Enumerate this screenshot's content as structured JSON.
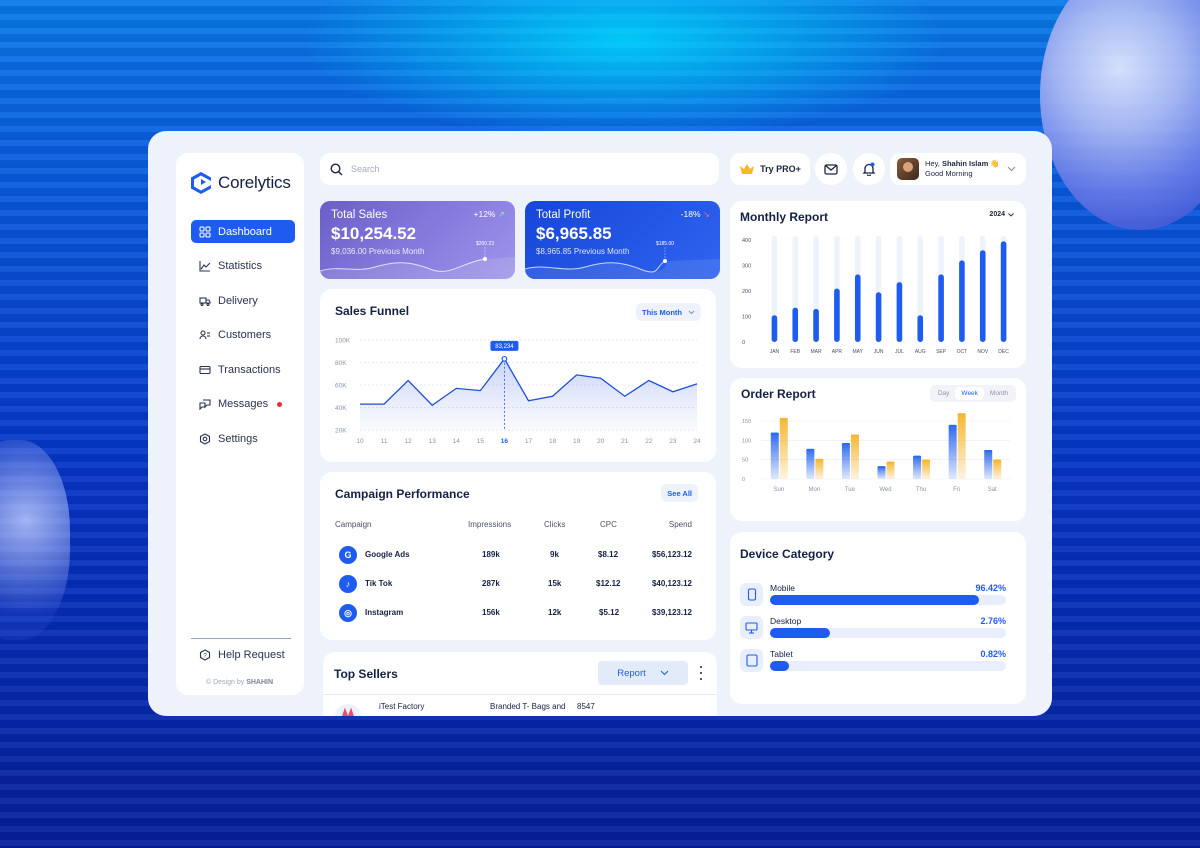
{
  "brand": {
    "name": "Corelytics"
  },
  "sidebar": {
    "items": [
      {
        "label": "Dashboard",
        "icon": "grid-icon"
      },
      {
        "label": "Statistics",
        "icon": "chart-icon"
      },
      {
        "label": "Delivery",
        "icon": "truck-icon"
      },
      {
        "label": "Customers",
        "icon": "users-icon"
      },
      {
        "label": "Transactions",
        "icon": "card-icon"
      },
      {
        "label": "Messages",
        "icon": "chat-icon"
      },
      {
        "label": "Settings",
        "icon": "settings-icon"
      }
    ],
    "help": "Help Request",
    "credit_prefix": "© Design by",
    "credit_name": "SHAHIN"
  },
  "search": {
    "placeholder": "Search"
  },
  "header": {
    "pro_label": "Try PRO+",
    "greeting_prefix": "Hey,",
    "user_name": "Shahin Islam",
    "wave": "👋",
    "subtitle": "Good Morning"
  },
  "kpi": {
    "sales": {
      "title": "Total Sales",
      "value": "$10,254.52",
      "delta": "+12%",
      "previous": "$9,036.00 Previous Month",
      "tag": "$200.23"
    },
    "profit": {
      "title": "Total Profit",
      "value": "$6,965.85",
      "delta": "-18%",
      "previous": "$8,965.85 Previous Month",
      "tag": "$185.00"
    }
  },
  "funnel": {
    "title": "Sales Funnel",
    "filter": "This Month",
    "tooltip": "83,234",
    "chart_data": {
      "type": "area",
      "x": [
        10,
        11,
        12,
        13,
        14,
        15,
        16,
        17,
        18,
        19,
        20,
        21,
        22,
        23,
        24
      ],
      "y_ticks": [
        "100K",
        "80K",
        "60K",
        "40K",
        "20K"
      ],
      "ylim": [
        20000,
        100000
      ],
      "values": [
        43000,
        43000,
        64000,
        42000,
        57000,
        55000,
        83234,
        46000,
        50000,
        69000,
        66000,
        50000,
        64000,
        54000,
        61000
      ],
      "highlight_x": 16
    }
  },
  "campaign": {
    "title": "Campaign Performance",
    "see_all": "See All",
    "columns": [
      "Campaign",
      "Impressions",
      "Clicks",
      "CPC",
      "Spend"
    ],
    "rows": [
      {
        "name": "Google Ads",
        "icon": "google-icon",
        "glyph": "G",
        "impressions": "189k",
        "clicks": "9k",
        "cpc": "$8.12",
        "spend": "$56,123.12"
      },
      {
        "name": "Tik Tok",
        "icon": "tiktok-icon",
        "glyph": "♪",
        "impressions": "287k",
        "clicks": "15k",
        "cpc": "$12.12",
        "spend": "$40,123.12"
      },
      {
        "name": "Instagram",
        "icon": "instagram-icon",
        "glyph": "◎",
        "impressions": "156k",
        "clicks": "12k",
        "cpc": "$5.12",
        "spend": "$39,123.12"
      }
    ]
  },
  "sellers": {
    "title": "Top Sellers",
    "report": "Report",
    "row": {
      "name": "iTest Factory",
      "product": "Branded T- Bags and",
      "qty": "8547"
    }
  },
  "monthly": {
    "title": "Monthly Report",
    "year": "2024",
    "chart_data": {
      "type": "bar",
      "categories": [
        "JAN",
        "FEB",
        "MAR",
        "APR",
        "MAY",
        "JUN",
        "JUL",
        "AUG",
        "SEP",
        "OCT",
        "NOV",
        "DEC"
      ],
      "values": [
        105,
        135,
        130,
        210,
        265,
        195,
        235,
        105,
        265,
        320,
        360,
        395
      ],
      "y_ticks": [
        "400",
        "300",
        "200",
        "100",
        "0"
      ],
      "ylim": [
        0,
        400
      ]
    }
  },
  "order": {
    "title": "Order Report",
    "tabs": [
      "Day",
      "Week",
      "Month"
    ],
    "active_tab": "Week",
    "chart_data": {
      "type": "bar",
      "categories": [
        "Sun",
        "Mon",
        "Tue",
        "Wed",
        "Thu",
        "Fri",
        "Sat"
      ],
      "y_ticks": [
        "150",
        "100",
        "50",
        "0"
      ],
      "ylim": [
        0,
        150
      ],
      "series": [
        {
          "values": [
            120,
            78,
            93,
            33,
            60,
            140,
            75
          ],
          "color": "#2f6bf0"
        },
        {
          "values": [
            158,
            52,
            115,
            45,
            50,
            170,
            50
          ],
          "color": "#f5b731"
        }
      ]
    }
  },
  "device": {
    "title": "Device Category",
    "items": [
      {
        "label": "Mobile",
        "value": "96.42%",
        "fraction": 0.8845,
        "icon": "mobile-icon"
      },
      {
        "label": "Desktop",
        "value": "2.76%",
        "fraction": 0.2522,
        "icon": "desktop-icon"
      },
      {
        "label": "Tablet",
        "value": "0.82%",
        "fraction": 0.0805,
        "icon": "tablet-icon"
      }
    ]
  }
}
